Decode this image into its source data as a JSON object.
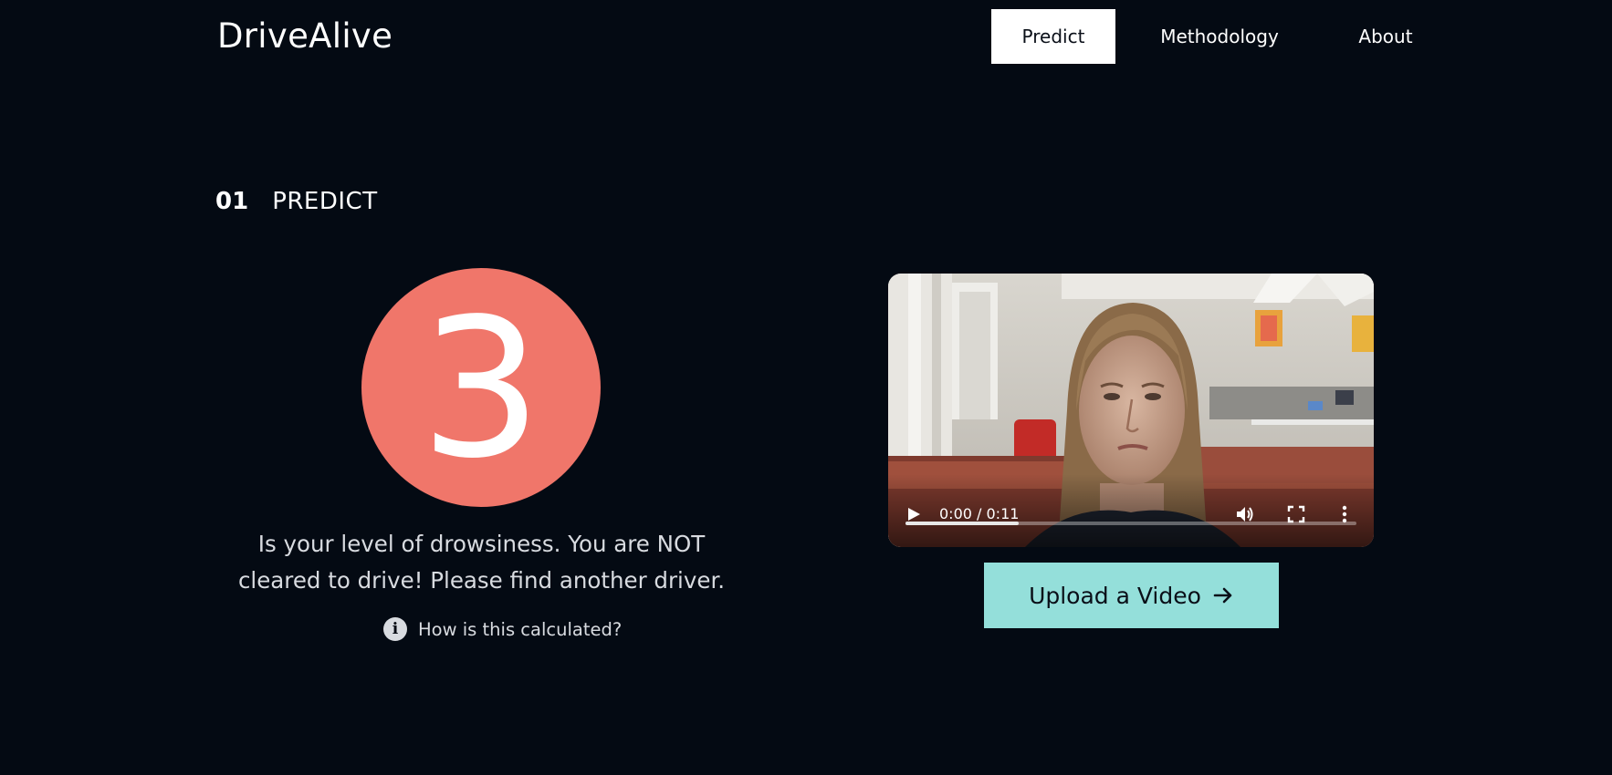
{
  "header": {
    "brand": "DriveAlive",
    "nav": [
      {
        "label": "Predict",
        "active": true
      },
      {
        "label": "Methodology",
        "active": false
      },
      {
        "label": "About",
        "active": false
      }
    ]
  },
  "section": {
    "number": "01",
    "title": "PREDICT"
  },
  "result": {
    "score": "3",
    "score_color": "#f0766a",
    "message": "Is your level of drowsiness. You are NOT cleared to drive! Please find another driver.",
    "how_calculated": "How is this calculated?"
  },
  "video": {
    "time": "0:00 / 0:11",
    "progress": 0.25,
    "icons": [
      "play-icon",
      "volume-icon",
      "fullscreen-icon",
      "more-options-icon"
    ]
  },
  "upload": {
    "label": "Upload a Video",
    "color": "#94dfda",
    "icon": "arrow-right-icon"
  }
}
